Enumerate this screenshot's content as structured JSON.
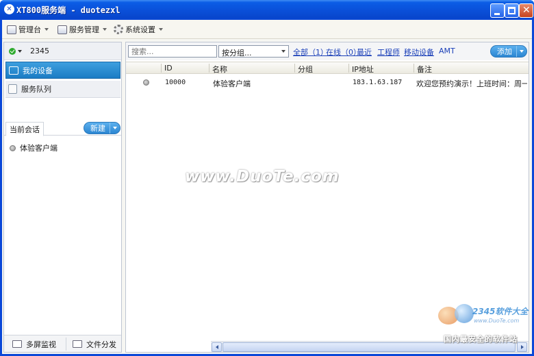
{
  "window": {
    "title": "XT800服务端 - duotezxl",
    "app_icon": "xt800-logo-icon",
    "controls": [
      "minimize-icon",
      "maximize-icon",
      "close-icon"
    ]
  },
  "menubar": {
    "items": [
      {
        "label": "管理台",
        "icon": "console-icon"
      },
      {
        "label": "服务管理",
        "icon": "service-icon"
      },
      {
        "label": "系统设置",
        "icon": "gear-icon"
      }
    ]
  },
  "sidebar": {
    "user": {
      "status": "online",
      "id": "2345"
    },
    "nav": [
      {
        "label": "我的设备",
        "icon": "monitor-icon",
        "active": true
      },
      {
        "label": "服务队列",
        "icon": "document-icon",
        "active": false
      }
    ],
    "session_tab": "当前会话",
    "new_button": "新建",
    "sessions": [
      {
        "label": "体验客户端",
        "status": "offline"
      }
    ],
    "bottom": [
      {
        "label": "多屏监视",
        "icon": "multi-screen-icon"
      },
      {
        "label": "文件分发",
        "icon": "file-distribute-icon"
      }
    ]
  },
  "devices": {
    "search_placeholder": "搜索...",
    "group_select": "按分组...",
    "filters": [
      {
        "label": "全部（1）",
        "underline": true
      },
      {
        "label": "在线（0）",
        "underline": true
      },
      {
        "label": "最近",
        "underline": true
      },
      {
        "label": "工程师",
        "underline": true
      },
      {
        "label": "移动设备",
        "underline": true
      },
      {
        "label": "AMT",
        "underline": false
      }
    ],
    "add_button": "添加",
    "columns": [
      "ID",
      "名称",
      "分组",
      "IP地址",
      "备注"
    ],
    "rows": [
      {
        "status": "offline",
        "id": "10000",
        "name": "体验客户端",
        "group": "",
        "ip": "183.1.63.187",
        "note": "欢迎您预约演示！上班时间：周一..."
      }
    ]
  },
  "watermarks": {
    "center": "www.DuoTe.com",
    "brand": "2345软件大全",
    "url": "www.DuoTe.com",
    "tagline": "国内最安全的软件站"
  },
  "colors": {
    "titlebar": "#0a48d8",
    "accent": "#1b7cc4",
    "link": "#1a3fb8"
  }
}
